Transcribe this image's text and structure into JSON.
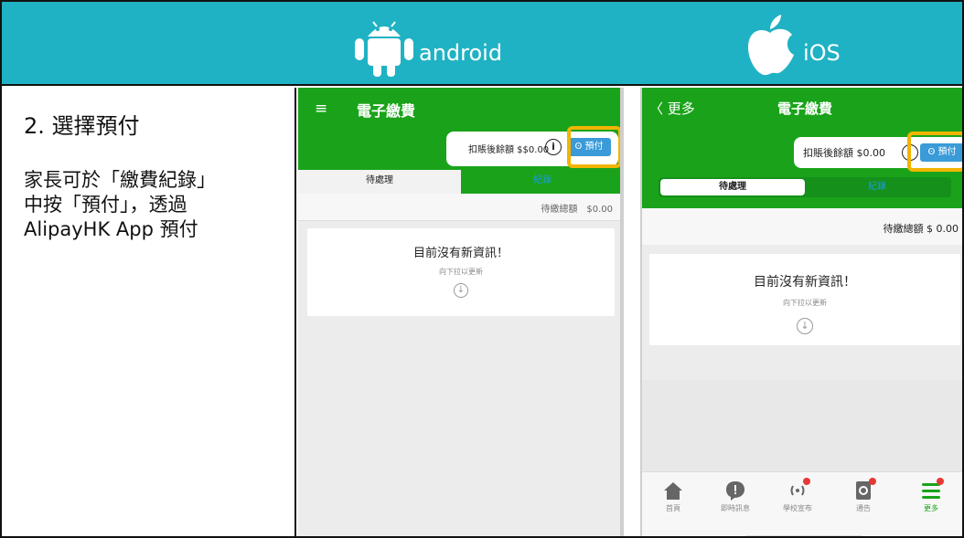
{
  "header": {
    "android_label": "android",
    "ios_label": "iOS",
    "bg_color": "#1fb2c4"
  },
  "left": {
    "step_title": "2. 選擇預付",
    "description_lines": [
      "家長可於「繳費紀錄」",
      "中按「預付」，透過",
      "AlipayHK App 預付"
    ]
  },
  "android": {
    "menu_icon": "≡",
    "title": "電子繳費",
    "balance_text": "扣賬後餘額 $$0.00",
    "info_icon": "i",
    "prepay_label": "ʘ 預付",
    "tabs": [
      "待處理",
      "紀錄"
    ],
    "due_text": "待繳總額　$0.00",
    "card_title": "目前沒有新資訊！",
    "card_sub": "向下拉以更新",
    "down_icon": "↓"
  },
  "ios": {
    "back_label": "〈 更多",
    "title": "電子繳費",
    "balance_text": "扣賬後餘額 $0.00",
    "info_icon": "i",
    "prepay_label": "ʘ 預付",
    "tabs": [
      "待處理",
      "紀錄"
    ],
    "due_text": "待繳總額 $ 0.00",
    "card_title": "目前沒有新資訊！",
    "card_sub": "向下拉以更新",
    "down_icon": "↓",
    "tabbar": [
      {
        "label": "首頁",
        "icon": "home-icon"
      },
      {
        "label": "即時訊息",
        "icon": "message-icon"
      },
      {
        "label": "學校宣布",
        "icon": "broadcast-icon"
      },
      {
        "label": "通告",
        "icon": "notice-icon"
      },
      {
        "label": "更多",
        "icon": "more-icon"
      }
    ]
  },
  "colors": {
    "app_green": "#1aa31a",
    "highlight": "#f2b400",
    "prepay_blue": "#3a9bd8",
    "record_tab_text": "#1d9ae0"
  }
}
